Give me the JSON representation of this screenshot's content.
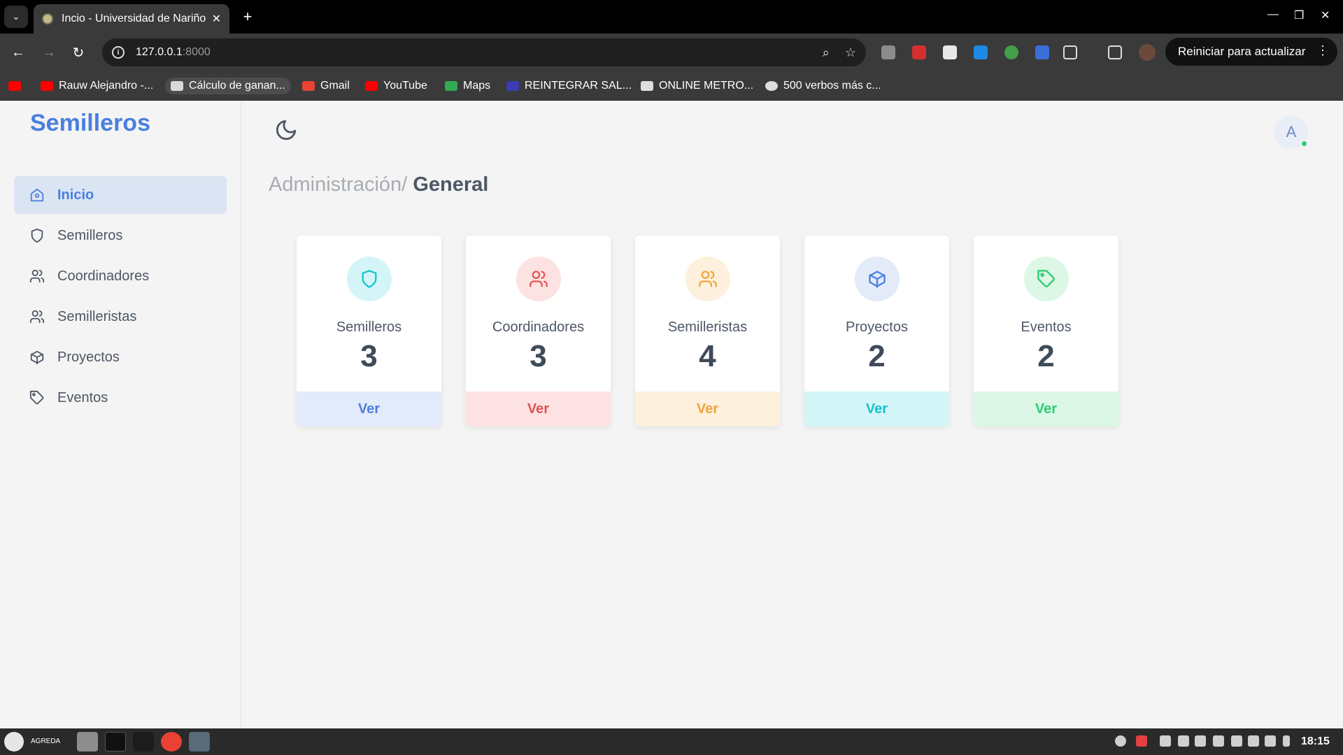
{
  "browser": {
    "tab_title": "Incio - Universidad de Nariño",
    "url_host": "127.0.0.1",
    "url_port": ":8000",
    "update_label": "Reiniciar para actualizar",
    "bookmarks": [
      {
        "label": ""
      },
      {
        "label": "Rauw Alejandro -..."
      },
      {
        "label": "Cálculo de ganan..."
      },
      {
        "label": "Gmail"
      },
      {
        "label": "YouTube"
      },
      {
        "label": "Maps"
      },
      {
        "label": "REINTEGRAR SAL..."
      },
      {
        "label": "ONLINE METRO..."
      },
      {
        "label": "500 verbos más c..."
      }
    ]
  },
  "app": {
    "brand": "Semilleros",
    "menu": [
      {
        "label": "Inicio",
        "icon": "home-icon",
        "active": true
      },
      {
        "label": "Semilleros",
        "icon": "shield-icon"
      },
      {
        "label": "Coordinadores",
        "icon": "users-icon"
      },
      {
        "label": "Semilleristas",
        "icon": "users-icon"
      },
      {
        "label": "Proyectos",
        "icon": "box-icon"
      },
      {
        "label": "Eventos",
        "icon": "tag-icon"
      }
    ],
    "avatar_initial": "A",
    "breadcrumb": {
      "parent": "Administración/",
      "current": "General"
    },
    "cards": [
      {
        "label": "Semilleros",
        "count": "3",
        "action": "Ver",
        "icon": "shield-icon",
        "accent": "#17c2cf",
        "circle_bg": "#d4f5f8",
        "button_bg": "#e3ebfa",
        "button_color": "#4a7fe0"
      },
      {
        "label": "Coordinadores",
        "count": "3",
        "action": "Ver",
        "icon": "users-icon",
        "accent": "#e85454",
        "circle_bg": "#fde2e2",
        "button_bg": "#fde2e4",
        "button_color": "#e05252"
      },
      {
        "label": "Semilleristas",
        "count": "4",
        "action": "Ver",
        "icon": "users-icon",
        "accent": "#f0a53a",
        "circle_bg": "#fdf0dc",
        "button_bg": "#fdf0dc",
        "button_color": "#f0a53a"
      },
      {
        "label": "Proyectos",
        "count": "2",
        "action": "Ver",
        "icon": "box-icon",
        "accent": "#4a7fe0",
        "circle_bg": "#e3ebfa",
        "button_bg": "#d4f5f8",
        "button_color": "#17c2cf"
      },
      {
        "label": "Eventos",
        "count": "2",
        "action": "Ver",
        "icon": "tag-icon",
        "accent": "#2ecc71",
        "circle_bg": "#dcf7e6",
        "button_bg": "#dcf7e6",
        "button_color": "#2ecc71"
      }
    ]
  },
  "taskbar": {
    "user": "AGREDA",
    "clock": "18:15"
  }
}
